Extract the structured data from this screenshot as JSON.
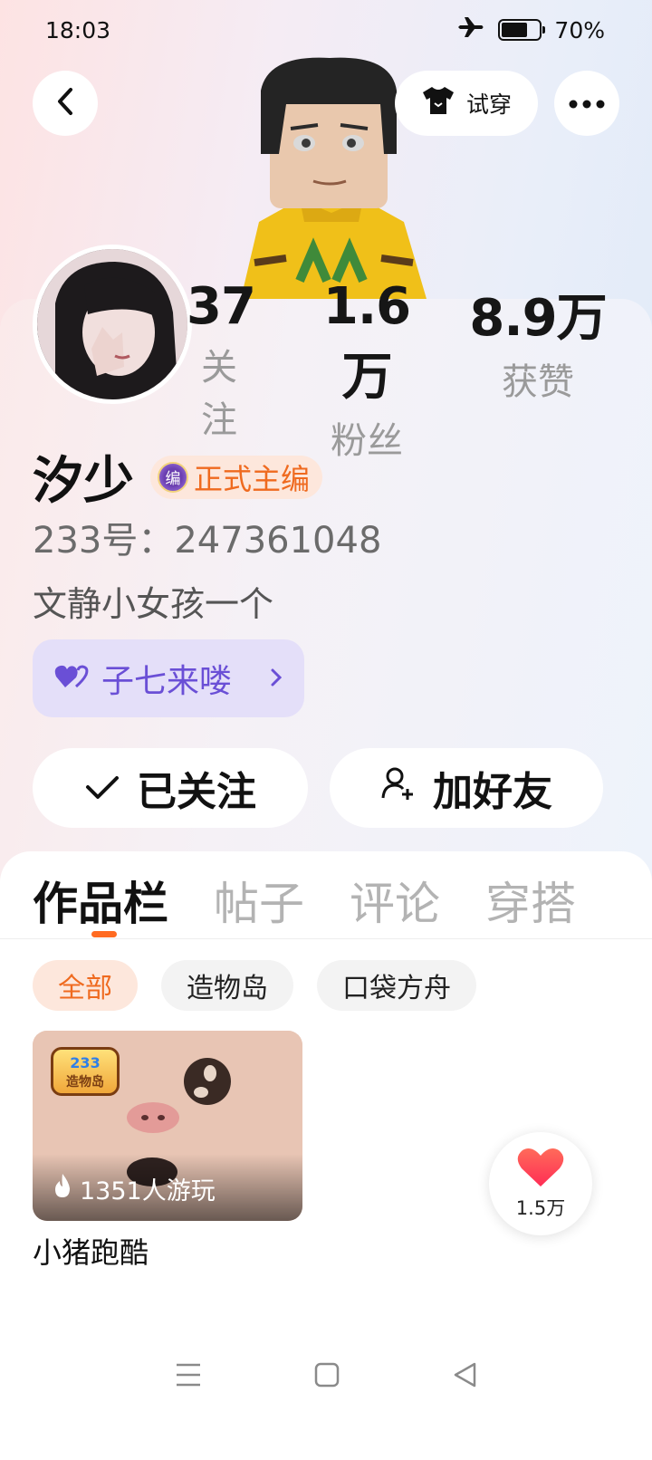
{
  "status_bar": {
    "time": "18:03",
    "battery": "70%",
    "battery_level": 0.7,
    "icons": [
      "airplane-icon",
      "battery-icon"
    ]
  },
  "header": {
    "try_on_label": "试穿",
    "icons": [
      "back-icon",
      "tshirt-icon",
      "more-icon"
    ]
  },
  "stats": [
    {
      "value": "37",
      "label": "关注"
    },
    {
      "value": "1.6万",
      "label": "粉丝"
    },
    {
      "value": "8.9万",
      "label": "获赞"
    }
  ],
  "profile": {
    "name": "汐少",
    "badge_icon_text": "编",
    "badge_label": "正式主编",
    "uid": "233号：247361048",
    "bio": "文静小女孩一个",
    "group_label": "子七来喽"
  },
  "actions": {
    "followed_label": "已关注",
    "add_friend_label": "加好友"
  },
  "tabs": [
    {
      "label": "作品栏",
      "active": true
    },
    {
      "label": "帖子",
      "active": false
    },
    {
      "label": "评论",
      "active": false
    },
    {
      "label": "穿搭",
      "active": false
    }
  ],
  "filters": [
    {
      "label": "全部",
      "active": true
    },
    {
      "label": "造物岛",
      "active": false
    },
    {
      "label": "口袋方舟",
      "active": false
    }
  ],
  "works": [
    {
      "title": "小猪跑酷",
      "plays": "1351人游玩",
      "logo_text": "233造物岛"
    }
  ],
  "like_fab": {
    "count": "1.5万"
  },
  "colors": {
    "accent": "#ef6a1f",
    "purple": "#6a4fd6",
    "like": "#ff3b4f"
  }
}
